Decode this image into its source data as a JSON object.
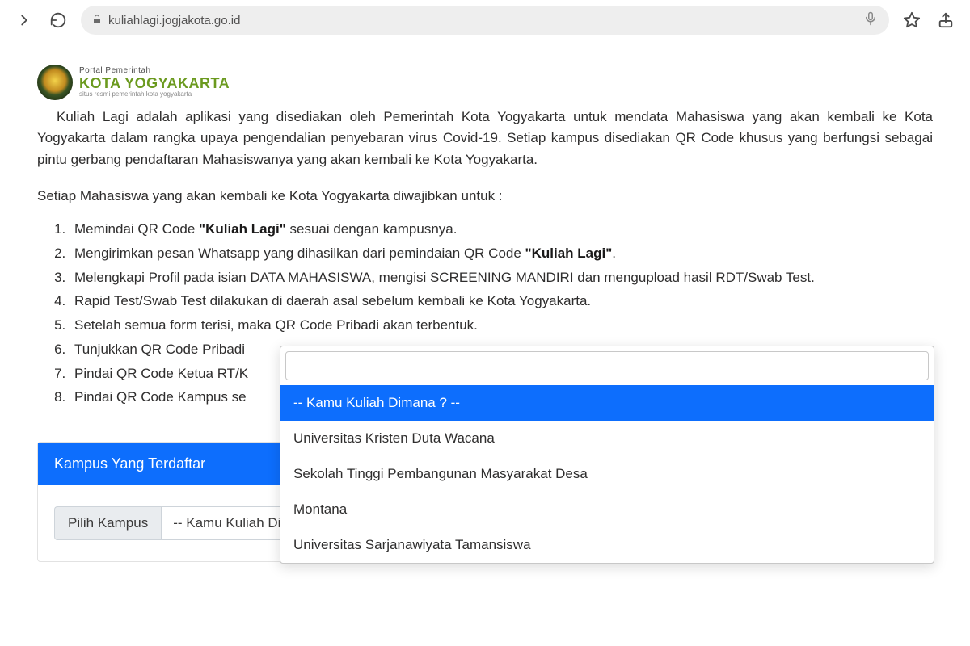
{
  "browser": {
    "url_host": "kuliahlagi.jogjakota.go.id"
  },
  "logo": {
    "line1": "Portal Pemerintah",
    "line2": "KOTA YOGYAKARTA",
    "line3": "situs resmi pemerintah kota yogyakarta"
  },
  "intro_paragraph": "Kuliah Lagi adalah aplikasi yang disediakan oleh Pemerintah Kota Yogyakarta untuk mendata Mahasiswa yang akan kembali ke Kota Yogyakarta dalam rangka upaya pengendalian penyebaran virus Covid-19. Setiap kampus disediakan QR Code khusus yang berfungsi sebagai pintu gerbang pendaftaran Mahasiswanya yang akan kembali ke Kota Yogyakarta.",
  "lead_in": "Setiap Mahasiswa yang akan kembali ke Kota Yogyakarta diwajibkan untuk :",
  "steps": [
    {
      "pre": "Memindai QR Code ",
      "bold": "\"Kuliah Lagi\"",
      "post": " sesuai dengan kampusnya."
    },
    {
      "pre": "Mengirimkan pesan Whatsapp yang dihasilkan dari pemindaian QR Code ",
      "bold": "\"Kuliah Lagi\"",
      "post": "."
    },
    {
      "pre": "Melengkapi Profil pada isian DATA MAHASISWA, mengisi SCREENING MANDIRI dan mengupload hasil RDT/Swab Test.",
      "bold": "",
      "post": ""
    },
    {
      "pre": "Rapid Test/Swab Test dilakukan di daerah asal sebelum kembali ke Kota Yogyakarta.",
      "bold": "",
      "post": ""
    },
    {
      "pre": "Setelah semua form terisi, maka QR Code Pribadi akan terbentuk.",
      "bold": "",
      "post": ""
    },
    {
      "pre": "Tunjukkan QR Code Pribadi",
      "bold": "",
      "post": ""
    },
    {
      "pre": "Pindai QR Code Ketua RT/K",
      "bold": "",
      "post": ""
    },
    {
      "pre": "Pindai QR Code Kampus se",
      "bold": "",
      "post": ""
    }
  ],
  "panel": {
    "header": "Kampus Yang Terdaftar",
    "field_label": "Pilih Kampus",
    "selected_value": "-- Kamu Kuliah Dimana ? --"
  },
  "dropdown": {
    "search_value": "",
    "options": [
      {
        "label": "-- Kamu Kuliah Dimana ? --",
        "highlighted": true
      },
      {
        "label": "Universitas Kristen Duta Wacana",
        "highlighted": false
      },
      {
        "label": "Sekolah Tinggi Pembangunan Masyarakat Desa",
        "highlighted": false
      },
      {
        "label": "Montana",
        "highlighted": false
      },
      {
        "label": "Universitas Sarjanawiyata Tamansiswa",
        "highlighted": false
      }
    ]
  }
}
